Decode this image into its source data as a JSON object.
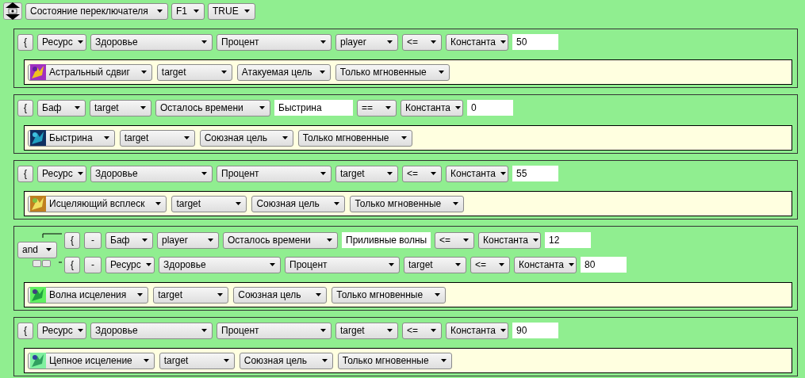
{
  "header": {
    "fields": [
      {
        "kind": "dropdown",
        "value": "Состояние переключателя"
      },
      {
        "kind": "dropdown",
        "value": "F1"
      },
      {
        "kind": "dropdown",
        "value": "TRUE"
      }
    ]
  },
  "blocks": [
    {
      "conditions": [
        {
          "kind": "resource",
          "open_button": "{",
          "fields": [
            {
              "kind": "dropdown",
              "value": "Ресурс"
            },
            {
              "kind": "dropdown",
              "value": "Здоровье"
            },
            {
              "kind": "dropdown",
              "value": "Процент"
            },
            {
              "kind": "dropdown",
              "value": "player"
            },
            {
              "kind": "dropdown",
              "value": "<="
            },
            {
              "kind": "dropdown",
              "value": "Константа"
            },
            {
              "kind": "input",
              "value": "50"
            }
          ]
        }
      ],
      "action": {
        "fields": [
          {
            "kind": "spell",
            "value": "Астральный сдвиг"
          },
          {
            "kind": "dropdown",
            "value": "target"
          },
          {
            "kind": "dropdown",
            "value": "Атакуемая цель"
          },
          {
            "kind": "dropdown",
            "value": "Только мгновенные"
          }
        ]
      }
    },
    {
      "conditions": [
        {
          "kind": "buff",
          "open_button": "{",
          "fields": [
            {
              "kind": "dropdown",
              "value": "Баф"
            },
            {
              "kind": "dropdown",
              "value": "target"
            },
            {
              "kind": "dropdown",
              "value": "Осталось времени"
            },
            {
              "kind": "input",
              "value": "Быстрина"
            },
            {
              "kind": "dropdown",
              "value": "=="
            },
            {
              "kind": "dropdown",
              "value": "Константа"
            },
            {
              "kind": "input",
              "value": "0"
            }
          ]
        }
      ],
      "action": {
        "fields": [
          {
            "kind": "spell",
            "value": "Быстрина"
          },
          {
            "kind": "dropdown",
            "value": "target"
          },
          {
            "kind": "dropdown",
            "value": "Союзная цель"
          },
          {
            "kind": "dropdown",
            "value": "Только мгновенные"
          }
        ]
      }
    },
    {
      "conditions": [
        {
          "kind": "resource",
          "open_button": "{",
          "fields": [
            {
              "kind": "dropdown",
              "value": "Ресурс"
            },
            {
              "kind": "dropdown",
              "value": "Здоровье"
            },
            {
              "kind": "dropdown",
              "value": "Процент"
            },
            {
              "kind": "dropdown",
              "value": "target"
            },
            {
              "kind": "dropdown",
              "value": "<="
            },
            {
              "kind": "dropdown",
              "value": "Константа"
            },
            {
              "kind": "input",
              "value": "55"
            }
          ]
        }
      ],
      "action": {
        "fields": [
          {
            "kind": "spell",
            "value": "Исцеляющий всплеск"
          },
          {
            "kind": "dropdown",
            "value": "target"
          },
          {
            "kind": "dropdown",
            "value": "Союзная цель"
          },
          {
            "kind": "dropdown",
            "value": "Только мгновенные"
          }
        ]
      }
    },
    {
      "logic": "and",
      "conditions": [
        {
          "kind": "buff",
          "open_button": "{",
          "remove_button": "-",
          "fields": [
            {
              "kind": "dropdown",
              "value": "Баф"
            },
            {
              "kind": "dropdown",
              "value": "player"
            },
            {
              "kind": "dropdown",
              "value": "Осталось времени"
            },
            {
              "kind": "input",
              "value": "Приливные волны"
            },
            {
              "kind": "dropdown",
              "value": "<="
            },
            {
              "kind": "dropdown",
              "value": "Константа"
            },
            {
              "kind": "input",
              "value": "12"
            }
          ]
        },
        {
          "kind": "resource",
          "open_button": "{",
          "remove_button": "-",
          "fields": [
            {
              "kind": "dropdown",
              "value": "Ресурс"
            },
            {
              "kind": "dropdown",
              "value": "Здоровье"
            },
            {
              "kind": "dropdown",
              "value": "Процент"
            },
            {
              "kind": "dropdown",
              "value": "target"
            },
            {
              "kind": "dropdown",
              "value": "<="
            },
            {
              "kind": "dropdown",
              "value": "Константа"
            },
            {
              "kind": "input",
              "value": "80"
            }
          ]
        }
      ],
      "action": {
        "fields": [
          {
            "kind": "spell",
            "value": "Волна исцеления"
          },
          {
            "kind": "dropdown",
            "value": "target"
          },
          {
            "kind": "dropdown",
            "value": "Союзная цель"
          },
          {
            "kind": "dropdown",
            "value": "Только мгновенные"
          }
        ]
      }
    },
    {
      "conditions": [
        {
          "kind": "resource",
          "open_button": "{",
          "fields": [
            {
              "kind": "dropdown",
              "value": "Ресурс"
            },
            {
              "kind": "dropdown",
              "value": "Здоровье"
            },
            {
              "kind": "dropdown",
              "value": "Процент"
            },
            {
              "kind": "dropdown",
              "value": "target"
            },
            {
              "kind": "dropdown",
              "value": "<="
            },
            {
              "kind": "dropdown",
              "value": "Константа"
            },
            {
              "kind": "input",
              "value": "90"
            }
          ]
        }
      ],
      "action": {
        "fields": [
          {
            "kind": "spell",
            "value": "Цепное исцеление"
          },
          {
            "kind": "dropdown",
            "value": "target"
          },
          {
            "kind": "dropdown",
            "value": "Союзная цель"
          },
          {
            "kind": "dropdown",
            "value": "Только мгновенные"
          }
        ]
      }
    }
  ]
}
